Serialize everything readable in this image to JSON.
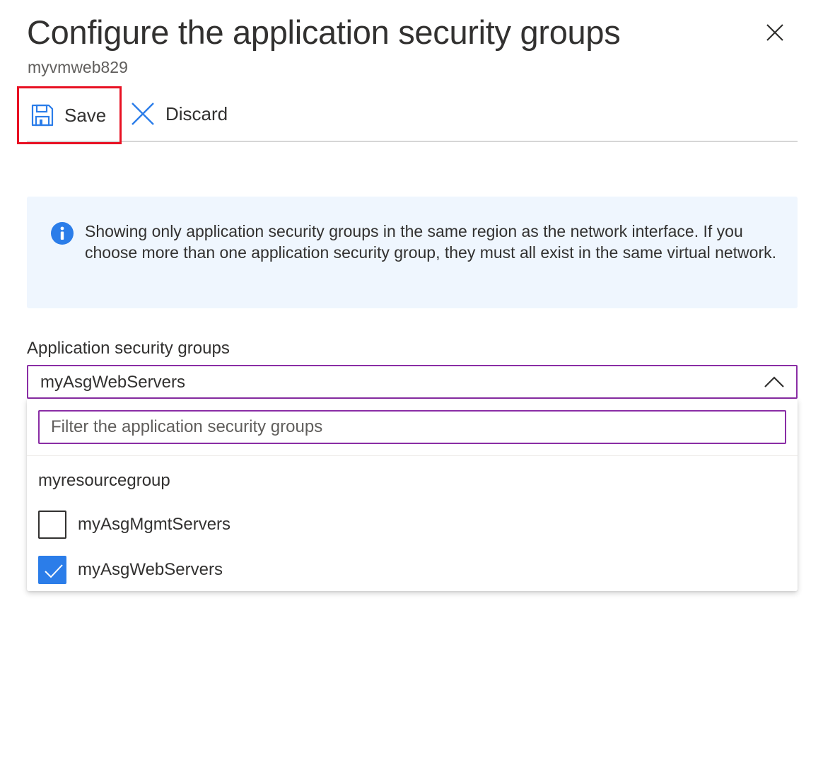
{
  "panel": {
    "title": "Configure the application security groups",
    "subtitle": "myvmweb829",
    "close_icon": "close-icon"
  },
  "toolbar": {
    "save_label": "Save",
    "save_icon": "floppy-disk-icon",
    "discard_label": "Discard",
    "discard_icon": "x-icon",
    "highlight_color": "#e81123"
  },
  "info": {
    "icon": "info-icon",
    "text": "Showing only application security groups in the same region as the network interface. If you choose more than one application security group, they must all exist in the same virtual network.",
    "background": "#eff6fe",
    "icon_color": "#2b7de9"
  },
  "asg_field": {
    "label": "Application security groups",
    "selected_value": "myAsgWebServers",
    "chevron_icon": "chevron-up-icon",
    "focus_color": "#8a2da5",
    "filter": {
      "value": "",
      "placeholder": "Filter the application security groups"
    },
    "group_name": "myresourcegroup",
    "options": [
      {
        "label": "myAsgMgmtServers",
        "checked": false
      },
      {
        "label": "myAsgWebServers",
        "checked": true
      }
    ]
  },
  "colors": {
    "accent": "#2b7de9",
    "text": "#323130",
    "subtext": "#605e5c"
  }
}
